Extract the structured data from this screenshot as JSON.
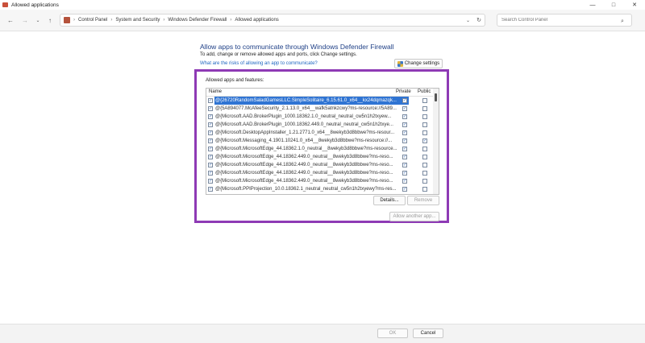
{
  "window": {
    "title": "Allowed applications",
    "minimize_glyph": "—",
    "maximize_glyph": "□",
    "close_glyph": "✕"
  },
  "nav": {
    "back_glyph": "←",
    "forward_glyph": "→",
    "dropdown_glyph": "⌄",
    "up_glyph": "↑",
    "breadcrumbs": [
      "Control Panel",
      "System and Security",
      "Windows Defender Firewall",
      "Allowed applications"
    ],
    "separator": "›",
    "addr_dropdown_glyph": "⌄",
    "refresh_glyph": "↻",
    "search_placeholder": "Search Control Panel",
    "search_glyph": "⌕"
  },
  "content": {
    "heading": "Allow apps to communicate through Windows Defender Firewall",
    "subtext": "To add, change or remove allowed apps and ports, click Change settings.",
    "risk_link": "What are the risks of allowing an app to communicate?",
    "change_settings": "Change settings",
    "group_label": "Allowed apps and features:",
    "columns": {
      "name": "Name",
      "private": "Private",
      "public": "Public"
    },
    "rows": [
      {
        "checked": true,
        "name": "@{26720RandomSaladGamesLLC.SimpleSolitaire_6.15.61.0_x64__kx24dqmazqk...",
        "private": true,
        "public": false,
        "selected": true
      },
      {
        "checked": true,
        "name": "@{5A894077.McAfeeSecurity_2.1.13.0_x64__wafk5atnkzcwy?ms-resource://5A89...",
        "private": true,
        "public": false,
        "selected": false
      },
      {
        "checked": true,
        "name": "@{Microsoft.AAD.BrokerPlugin_1000.18362.1.0_neutral_neutral_cw5n1h2txyew...",
        "private": true,
        "public": false,
        "selected": false
      },
      {
        "checked": true,
        "name": "@{Microsoft.AAD.BrokerPlugin_1000.18362.449.0_neutral_neutral_cw5n1h2txye...",
        "private": true,
        "public": false,
        "selected": false
      },
      {
        "checked": true,
        "name": "@{Microsoft.DesktopAppInstaller_1.21.2771.0_x64__8wekyb3d8bbwe?ms-resour...",
        "private": true,
        "public": false,
        "selected": false
      },
      {
        "checked": true,
        "name": "@{Microsoft.Messaging_4.1901.10241.0_x64__8wekyb3d8bbwe?ms-resource://...",
        "private": true,
        "public": true,
        "selected": false
      },
      {
        "checked": true,
        "name": "@{Microsoft.MicrosoftEdge_44.18362.1.0_neutral__8wekyb3d8bbwe?ms-resource...",
        "private": true,
        "public": false,
        "selected": false
      },
      {
        "checked": true,
        "name": "@{Microsoft.MicrosoftEdge_44.18362.449.0_neutral__8wekyb3d8bbwe?ms-reso...",
        "private": true,
        "public": false,
        "selected": false
      },
      {
        "checked": true,
        "name": "@{Microsoft.MicrosoftEdge_44.18362.449.0_neutral__8wekyb3d8bbwe?ms-reso...",
        "private": true,
        "public": false,
        "selected": false
      },
      {
        "checked": true,
        "name": "@{Microsoft.MicrosoftEdge_44.18362.449.0_neutral__8wekyb3d8bbwe?ms-reso...",
        "private": true,
        "public": false,
        "selected": false
      },
      {
        "checked": true,
        "name": "@{Microsoft.MicrosoftEdge_44.18362.449.0_neutral__8wekyb3d8bbwe?ms-reso...",
        "private": true,
        "public": false,
        "selected": false
      },
      {
        "checked": true,
        "name": "@{Microsoft.PPIProjection_10.0.18362.1_neutral_neutral_cw5n1h2txyewy?ms-res...",
        "private": true,
        "public": false,
        "selected": false
      },
      {
        "checked": true,
        "name": "@{Microsoft.PPIProjection_10.0.18362.449.0_neutral_neutral_cw5n1h2txyewy?ms...",
        "private": true,
        "public": false,
        "selected": false
      }
    ],
    "check_glyph": "✓",
    "details": "Details...",
    "remove": "Remove",
    "allow_another": "Allow another app..."
  },
  "footer": {
    "ok": "OK",
    "cancel": "Cancel"
  },
  "colors": {
    "accent": "#2f74d3",
    "highlight_border": "#8e3ab5",
    "heading": "#1e3f86",
    "link": "#1e66c0"
  }
}
